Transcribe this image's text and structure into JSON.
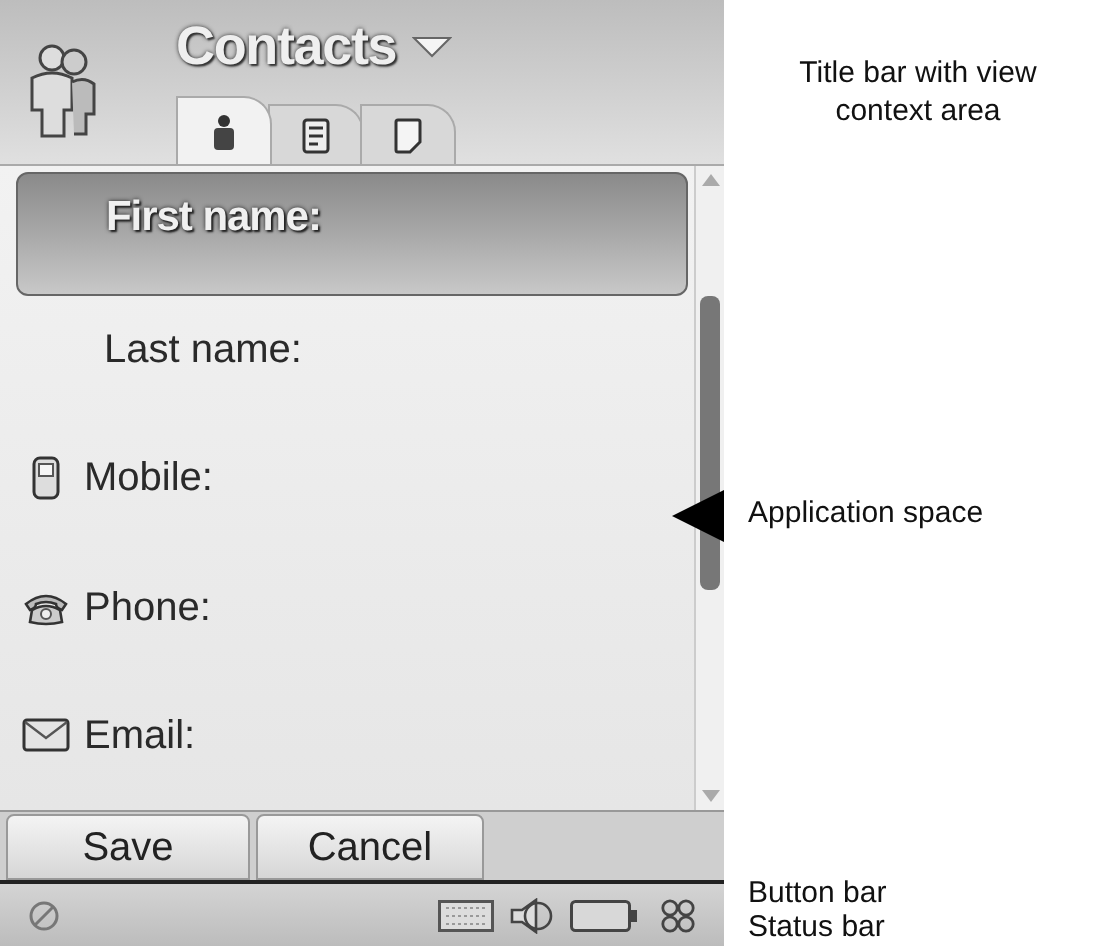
{
  "title_bar": {
    "title": "Contacts",
    "tabs": [
      {
        "kind": "person",
        "selected": true
      },
      {
        "kind": "card",
        "selected": false
      },
      {
        "kind": "note",
        "selected": false
      }
    ]
  },
  "fields": [
    {
      "label": "First name:",
      "kind": "plain",
      "selected": true
    },
    {
      "label": "Last name:",
      "kind": "plain",
      "selected": false
    },
    {
      "label": "Mobile:",
      "kind": "mobile",
      "selected": false
    },
    {
      "label": "Phone:",
      "kind": "phone",
      "selected": false
    },
    {
      "label": "Email:",
      "kind": "email",
      "selected": false
    }
  ],
  "buttons": [
    "Save",
    "Cancel"
  ],
  "annotations": [
    "Title bar with view context area",
    "Application space",
    "Button bar",
    "Status bar"
  ]
}
